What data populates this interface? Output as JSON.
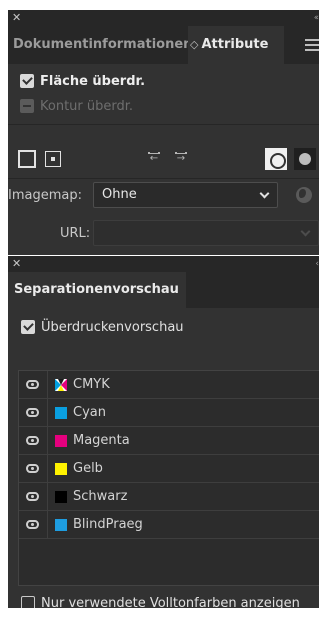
{
  "attribute_panel": {
    "tabs": [
      {
        "label": "Dokumentinformationen",
        "active": false
      },
      {
        "label": "Attribute",
        "active": true
      }
    ],
    "overprint_fill": {
      "label": "Fläche überdr.",
      "checked": true
    },
    "overprint_stroke": {
      "label": "Kontur überdr.",
      "checked": false,
      "disabled": true
    },
    "imagemap": {
      "label": "Imagemap:",
      "value": "Ohne"
    },
    "url": {
      "label": "URL:",
      "value": ""
    }
  },
  "separation_panel": {
    "tab": {
      "label": "Separationenvorschau"
    },
    "overprint_preview": {
      "label": "Überdruckenvorschau",
      "checked": true
    },
    "plates": [
      {
        "name": "CMYK",
        "swatch": "cmyk",
        "visible": true
      },
      {
        "name": "Cyan",
        "swatch": "#0a9fe0",
        "visible": true
      },
      {
        "name": "Magenta",
        "swatch": "#e5007e",
        "visible": true
      },
      {
        "name": "Gelb",
        "swatch": "#fff200",
        "visible": true
      },
      {
        "name": "Schwarz",
        "swatch": "#000000",
        "visible": true
      },
      {
        "name": "BlindPraeg",
        "swatch": "#1e9de0",
        "visible": true
      }
    ],
    "spot_only": {
      "label": "Nur verwendete Volltonfarben anzeigen",
      "checked": false
    }
  },
  "icons": {
    "close": "close-icon",
    "collapse": "collapse-icon",
    "menu": "hamburger-menu-icon",
    "eye": "eye-icon",
    "globe": "globe-icon"
  },
  "colors": {
    "panel_bg": "#323232",
    "tabstrip_bg": "#272727",
    "text": "#d6d6d6"
  }
}
